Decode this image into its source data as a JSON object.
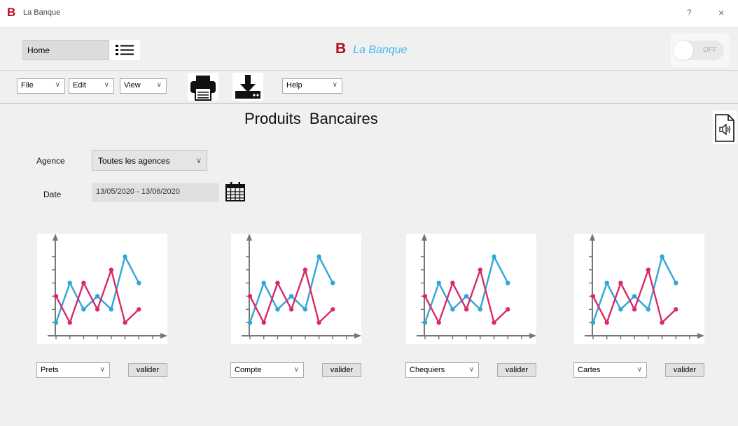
{
  "window": {
    "title": "La Banque",
    "logo_letter": "B",
    "help_glyph": "?",
    "close_glyph": "×"
  },
  "header": {
    "home_value": "Home",
    "brand_letter": "B",
    "brand_name": "La Banque",
    "toggle_label": "OFF"
  },
  "menubar": {
    "file": "File",
    "edit": "Edit",
    "view": "View",
    "help": "Help"
  },
  "page": {
    "title": "Produits  Bancaires"
  },
  "form": {
    "agence_label": "Agence",
    "agence_value": "Toutes les agences",
    "date_label": "Date",
    "date_value": "13/05/2020 - 13/06/2020"
  },
  "products": [
    {
      "select_value": "Prets",
      "button_label": "valider"
    },
    {
      "select_value": "Compte",
      "button_label": "valider"
    },
    {
      "select_value": "Chequiers",
      "button_label": "valider"
    },
    {
      "select_value": "Cartes",
      "button_label": "valider"
    }
  ],
  "chart_data": {
    "type": "line",
    "x": [
      1,
      2,
      3,
      4,
      5,
      6,
      7,
      8
    ],
    "series": [
      {
        "color": "#2fa6d6",
        "values": [
          1,
          4,
          2,
          3,
          2,
          6,
          4,
          null
        ]
      },
      {
        "color": "#d9296a",
        "values": [
          3,
          1,
          4,
          2,
          5,
          1,
          2,
          null
        ]
      }
    ],
    "note_copies": 4
  },
  "colors": {
    "brand_red": "#b30d1f",
    "brand_blue": "#41b8e8",
    "series_blue": "#2fa6d6",
    "series_pink": "#d9296a"
  },
  "icons": {
    "list": "list-icon",
    "printer": "printer-icon",
    "download": "download-icon",
    "calendar": "calendar-icon",
    "audio_document": "audio-document-icon",
    "toggle": "toggle-switch",
    "chevron": "chevron-down-icon"
  }
}
